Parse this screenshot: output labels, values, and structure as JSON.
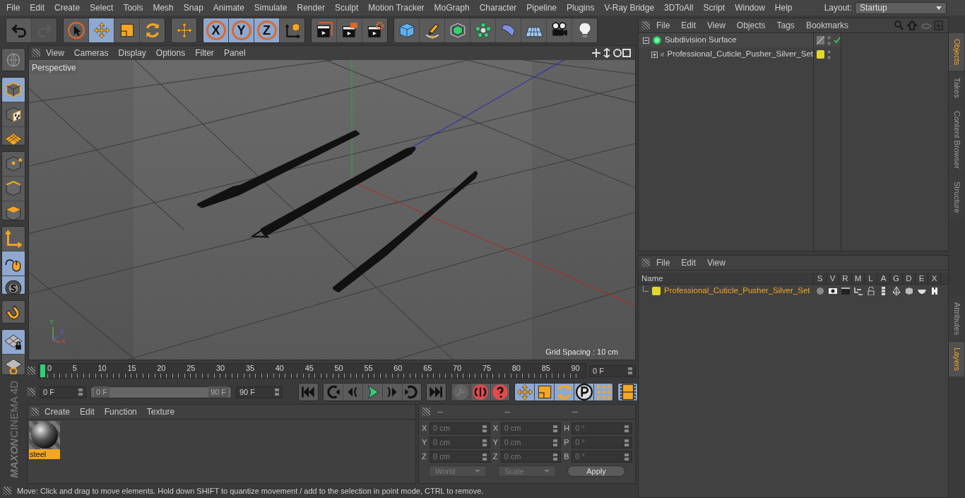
{
  "menu_bar": {
    "items": [
      "File",
      "Edit",
      "Create",
      "Select",
      "Tools",
      "Mesh",
      "Snap",
      "Animate",
      "Simulate",
      "Render",
      "Sculpt",
      "Motion Tracker",
      "MoGraph",
      "Character",
      "Pipeline",
      "Plugins",
      "V-Ray Bridge",
      "3DToAll",
      "Script",
      "Window",
      "Help"
    ],
    "layout_label": "Layout:",
    "layout_value": "Startup"
  },
  "toolbar": [
    [
      {
        "kind": "undo",
        "selected": false,
        "disabled": false
      },
      {
        "kind": "redo",
        "selected": false,
        "disabled": true
      }
    ],
    [
      {
        "kind": "select",
        "selected": false,
        "disabled": false
      },
      {
        "kind": "move",
        "selected": true,
        "disabled": false
      },
      {
        "kind": "scale",
        "selected": false,
        "disabled": false
      },
      {
        "kind": "rotate",
        "selected": false,
        "disabled": false
      }
    ],
    [
      {
        "kind": "move",
        "selected": false,
        "disabled": false
      }
    ],
    [
      {
        "kind": "axis",
        "label": "X",
        "selected": true,
        "disabled": false
      },
      {
        "kind": "axis",
        "label": "Y",
        "selected": true,
        "disabled": false
      },
      {
        "kind": "axis",
        "label": "Z",
        "selected": true,
        "disabled": false
      },
      {
        "kind": "coords",
        "selected": false,
        "disabled": false
      }
    ],
    [
      {
        "kind": "renderview",
        "selected": false,
        "disabled": false
      },
      {
        "kind": "render",
        "selected": false,
        "disabled": false
      },
      {
        "kind": "rendersettings",
        "selected": false,
        "disabled": false
      }
    ],
    [
      {
        "kind": "cube",
        "selected": false,
        "disabled": false
      },
      {
        "kind": "pen",
        "selected": false,
        "disabled": false
      },
      {
        "kind": "subdivision",
        "selected": false,
        "disabled": false
      },
      {
        "kind": "cloner",
        "selected": false,
        "disabled": false
      },
      {
        "kind": "deformer",
        "selected": false,
        "disabled": false
      },
      {
        "kind": "floor",
        "selected": false,
        "disabled": false
      },
      {
        "kind": "camera",
        "selected": false,
        "disabled": false
      },
      {
        "kind": "light",
        "selected": false,
        "disabled": false
      }
    ]
  ],
  "tool_strip": [
    [
      {
        "kind": "globe",
        "selected": false
      }
    ],
    [
      {
        "kind": "model",
        "selected": true
      },
      {
        "kind": "texture",
        "selected": false
      },
      {
        "kind": "workplane",
        "selected": false
      }
    ],
    [
      {
        "kind": "points",
        "selected": false
      },
      {
        "kind": "edges",
        "selected": false
      },
      {
        "kind": "polygons",
        "selected": false
      }
    ],
    [
      {
        "kind": "axistool",
        "selected": false
      },
      {
        "kind": "tweak",
        "selected": true
      },
      {
        "kind": "snap",
        "selected": true
      }
    ],
    [
      {
        "kind": "magnet",
        "selected": false
      }
    ],
    [
      {
        "kind": "gridlock",
        "selected": true
      },
      {
        "kind": "gridrotate",
        "selected": false
      }
    ]
  ],
  "logo_text": [
    "MAXON",
    "CINEMA 4D"
  ],
  "viewport": {
    "menu": [
      "View",
      "Cameras",
      "Display",
      "Options",
      "Filter",
      "Panel"
    ],
    "camera_label": "Perspective",
    "grid_spacing": "Grid Spacing : 10 cm",
    "axis_labels": [
      "Y",
      "Z",
      "X"
    ]
  },
  "timeline": {
    "ruler_labels": [
      "0",
      "5",
      "10",
      "15",
      "20",
      "25",
      "30",
      "35",
      "40",
      "45",
      "50",
      "55",
      "60",
      "65",
      "70",
      "75",
      "80",
      "85",
      "90"
    ],
    "playhead": {
      "level": 0
    },
    "current_frame": "0 F",
    "start_field": "0 F",
    "range": {
      "start": "0 F",
      "end": "90 F",
      "level": 1
    },
    "end_field": "90 F",
    "transport": [
      [
        {
          "kind": "first",
          "disabled": false,
          "selected": false
        }
      ],
      [
        {
          "kind": "prevkey",
          "disabled": false,
          "selected": false
        },
        {
          "kind": "prevframe",
          "disabled": false,
          "selected": false
        },
        {
          "kind": "play",
          "disabled": false,
          "selected": false
        },
        {
          "kind": "nextframe",
          "disabled": false,
          "selected": false
        },
        {
          "kind": "nextkey",
          "disabled": false,
          "selected": false
        }
      ],
      [
        {
          "kind": "last",
          "disabled": false,
          "selected": false
        }
      ],
      [
        {
          "kind": "key",
          "disabled": true,
          "selected": false
        },
        {
          "kind": "record",
          "disabled": false,
          "selected": false
        },
        {
          "kind": "autokey",
          "disabled": false,
          "selected": false
        }
      ],
      [
        {
          "kind": "move",
          "disabled": false,
          "selected": true
        },
        {
          "kind": "scale",
          "disabled": false,
          "selected": true
        },
        {
          "kind": "rotate",
          "disabled": false,
          "selected": true
        },
        {
          "kind": "param",
          "disabled": false,
          "selected": true
        },
        {
          "kind": "dots",
          "disabled": false,
          "selected": true
        }
      ],
      [
        {
          "kind": "film",
          "disabled": false,
          "selected": true
        }
      ]
    ]
  },
  "material_manager": {
    "menu": [
      "Create",
      "Edit",
      "Function",
      "Texture"
    ],
    "materials": [
      {
        "name": "steel",
        "selected": true
      }
    ]
  },
  "coordinates": {
    "headers": [
      "--",
      "--",
      "--"
    ],
    "columns": [
      [
        {
          "label": "X",
          "value": "0 cm"
        },
        {
          "label": "Y",
          "value": "0 cm"
        },
        {
          "label": "Z",
          "value": "0 cm"
        }
      ],
      [
        {
          "label": "X",
          "value": "0 cm"
        },
        {
          "label": "Y",
          "value": "0 cm"
        },
        {
          "label": "Z",
          "value": "0 cm"
        }
      ],
      [
        {
          "label": "H",
          "value": "0 °"
        },
        {
          "label": "P",
          "value": "0 °"
        },
        {
          "label": "B",
          "value": "0 °"
        }
      ]
    ],
    "dropdowns": [
      {
        "value": "World",
        "disabled": true
      },
      {
        "value": "Scale",
        "disabled": true
      }
    ],
    "apply": "Apply"
  },
  "status_bar": "Move: Click and drag to move elements. Hold down SHIFT to quantize movement / add to the selection in point mode, CTRL to remove.",
  "object_manager": {
    "menu": [
      "File",
      "Edit",
      "View",
      "Objects",
      "Tags",
      "Bookmarks"
    ],
    "tree": [
      {
        "name": "Subdivision Surface",
        "kind": "subdivision",
        "expanded": true,
        "enabled": true,
        "children": [
          {
            "name": "Professional_Cuticle_Pusher_Silver_Set",
            "kind": "null",
            "expanded": false,
            "enabled": false,
            "color": "#e2d82c"
          }
        ]
      }
    ]
  },
  "side_tabs_top": [
    {
      "label": "Objects",
      "selected": true
    },
    {
      "label": "Takes",
      "selected": false
    },
    {
      "label": "Content Browser",
      "selected": false
    },
    {
      "label": "Structure",
      "selected": false
    }
  ],
  "side_tabs_bottom": [
    {
      "label": "Attributes",
      "selected": false
    },
    {
      "label": "Layers",
      "selected": true
    }
  ],
  "layer_manager": {
    "menu": [
      "File",
      "Edit",
      "View"
    ],
    "columns": [
      "Name",
      "S",
      "V",
      "R",
      "M",
      "L",
      "A",
      "G",
      "D",
      "E",
      "X"
    ],
    "rows": [
      {
        "name": "Professional_Cuticle_Pusher_Silver_Set",
        "color": "#e2d82c",
        "selected": true
      }
    ]
  }
}
